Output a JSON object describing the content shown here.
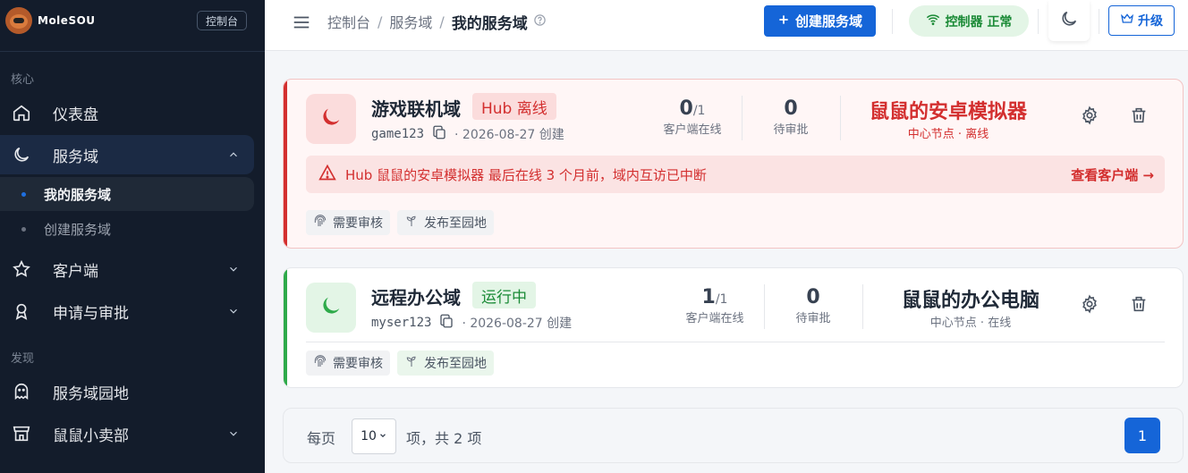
{
  "sidebar": {
    "brand": "MoleSOU",
    "console_tag": "控制台",
    "sections": {
      "core": "核心",
      "discover": "发现"
    },
    "items": {
      "dashboard": "仪表盘",
      "domains": "服务域",
      "my_domains": "我的服务域",
      "create_domain": "创建服务域",
      "clients": "客户端",
      "requests": "申请与审批",
      "garden": "服务域园地",
      "shop": "鼠鼠小卖部"
    }
  },
  "topbar": {
    "breadcrumb": [
      "控制台",
      "服务域",
      "我的服务域"
    ],
    "sep": "/",
    "create_label": "创建服务域",
    "status_label": "控制器 正常",
    "upgrade_label": "升级"
  },
  "cards": [
    {
      "name": "游戏联机域",
      "badge": "Hub 离线",
      "slug": "game123",
      "created": "· 2026-08-27 创建",
      "online_num": "0",
      "online_total": "/1",
      "online_cap": "客户端在线",
      "pending_num": "0",
      "pending_cap": "待审批",
      "hub_name": "鼠鼠的安卓模拟器",
      "hub_sub": "中心节点 · 离线",
      "alert_text": "Hub 鼠鼠的安卓模拟器 最后在线 3 个月前，域内互访已中断",
      "alert_link": "查看客户端 →",
      "tag_review": "需要审核",
      "tag_publish": "发布至园地"
    },
    {
      "name": "远程办公域",
      "badge": "运行中",
      "slug": "myser123",
      "created": "· 2026-08-27 创建",
      "online_num": "1",
      "online_total": "/1",
      "online_cap": "客户端在线",
      "pending_num": "0",
      "pending_cap": "待审批",
      "hub_name": "鼠鼠的办公电脑",
      "hub_sub": "中心节点 · 在线",
      "tag_review": "需要审核",
      "tag_publish": "发布至园地"
    }
  ],
  "pager": {
    "per_page_label": "每页",
    "per_page_value": "10",
    "total_label": "项，共 2 项",
    "current_page": "1"
  },
  "colors": {
    "accent": "#1565d8",
    "danger": "#d32f2f",
    "success": "#2eaa4a",
    "sidebar_bg": "#131c2b"
  }
}
